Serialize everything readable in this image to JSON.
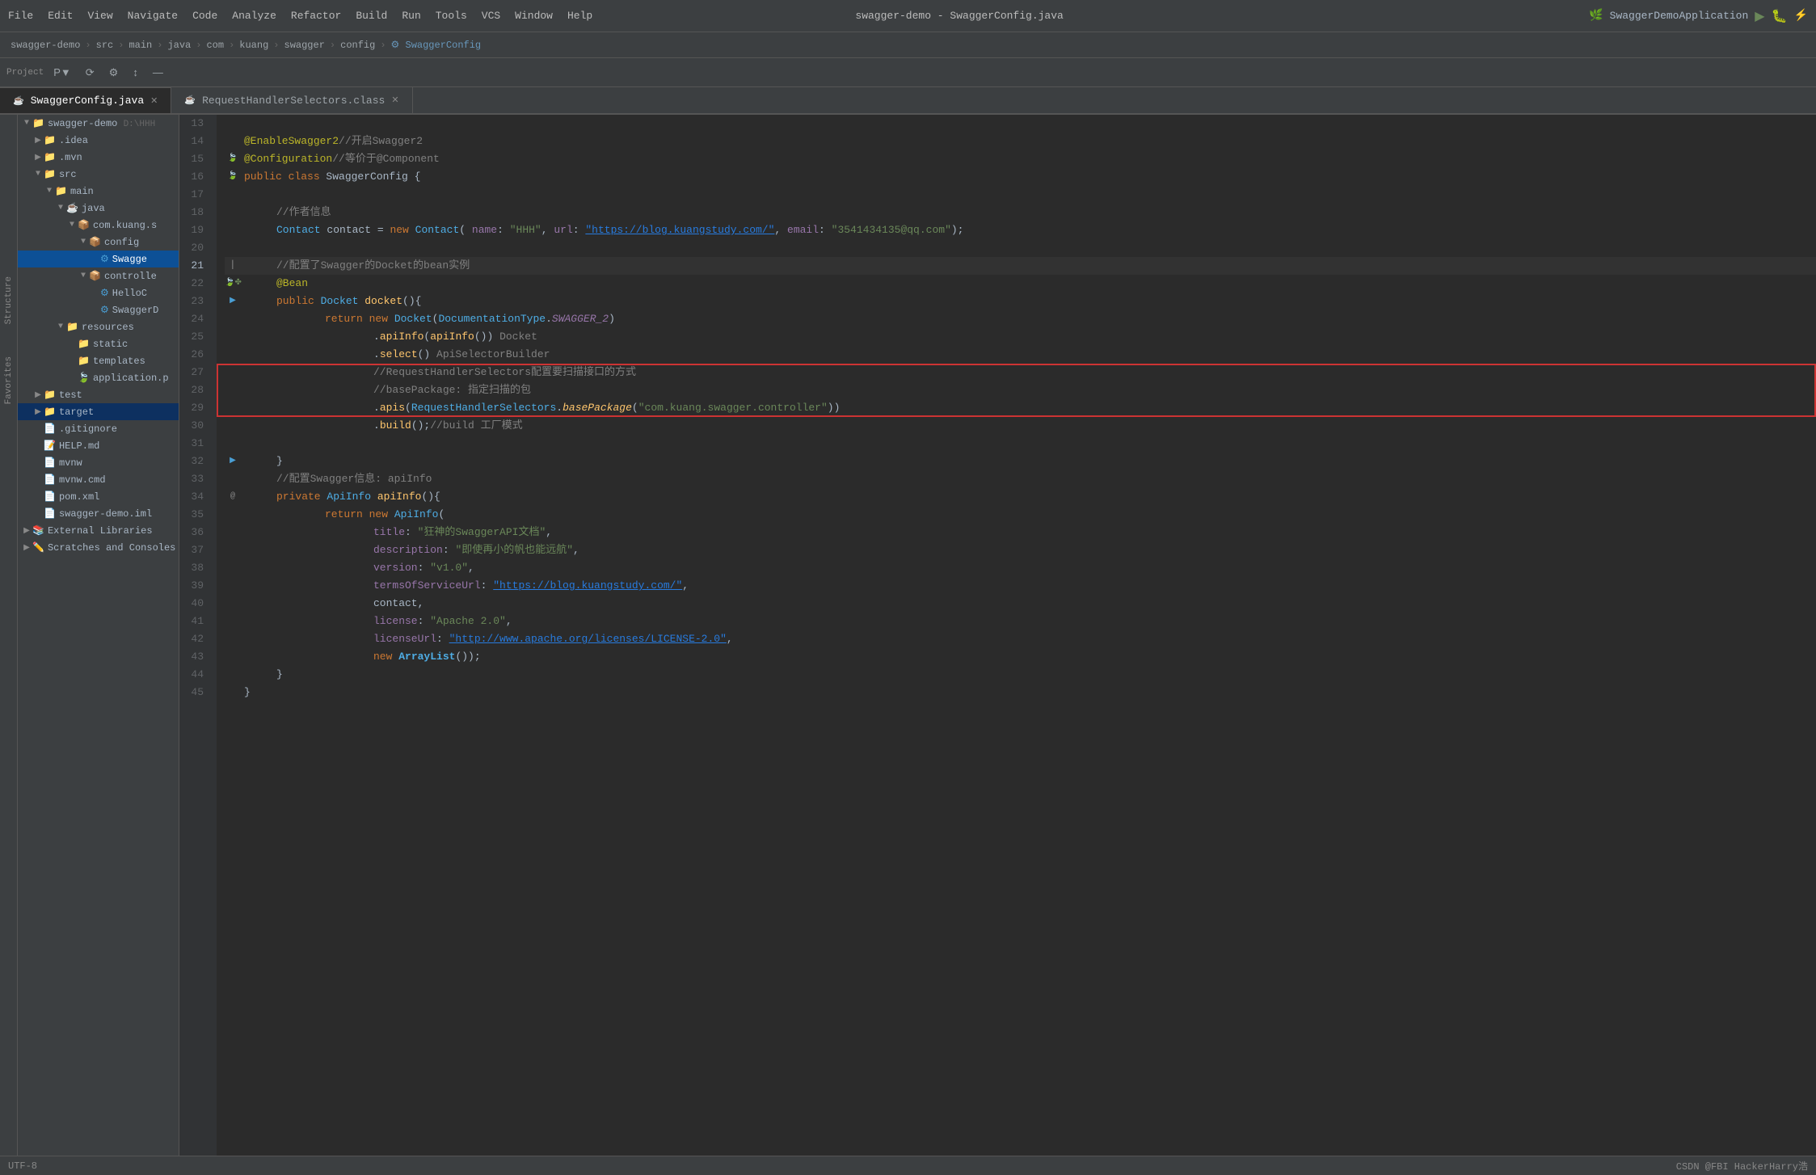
{
  "titlebar": {
    "menus": [
      "File",
      "Edit",
      "View",
      "Navigate",
      "Code",
      "Analyze",
      "Refactor",
      "Build",
      "Run",
      "Tools",
      "VCS",
      "Window",
      "Help"
    ],
    "title": "swagger-demo - SwaggerConfig.java"
  },
  "breadcrumb": {
    "items": [
      "swagger-demo",
      "src",
      "main",
      "java",
      "com",
      "kuang",
      "swagger",
      "config",
      "SwaggerConfig"
    ]
  },
  "tabs": [
    {
      "label": "SwaggerConfig.java",
      "active": true,
      "icon": "java"
    },
    {
      "label": "RequestHandlerSelectors.class",
      "active": false,
      "icon": "java"
    }
  ],
  "sidebar": {
    "project_label": "Project",
    "items": [
      {
        "id": "swagger-demo",
        "label": "swagger-demo",
        "type": "module",
        "indent": 0,
        "expanded": true,
        "suffix": "D:\\HHH"
      },
      {
        "id": "idea",
        "label": ".idea",
        "type": "folder",
        "indent": 1,
        "expanded": false
      },
      {
        "id": "mvn",
        "label": ".mvn",
        "type": "folder",
        "indent": 1,
        "expanded": false
      },
      {
        "id": "src",
        "label": "src",
        "type": "folder",
        "indent": 1,
        "expanded": true
      },
      {
        "id": "main",
        "label": "main",
        "type": "folder",
        "indent": 2,
        "expanded": true
      },
      {
        "id": "java",
        "label": "java",
        "type": "folder-java",
        "indent": 3,
        "expanded": true
      },
      {
        "id": "com.kuang.s",
        "label": "com.kuang.s",
        "type": "package",
        "indent": 4,
        "expanded": true
      },
      {
        "id": "config",
        "label": "config",
        "type": "package",
        "indent": 5,
        "expanded": true
      },
      {
        "id": "SwaggerConfig",
        "label": "Swagge",
        "type": "java-class",
        "indent": 6,
        "expanded": false,
        "selected": true
      },
      {
        "id": "controller",
        "label": "controlle",
        "type": "package",
        "indent": 5,
        "expanded": true
      },
      {
        "id": "HelloC",
        "label": "HelloC",
        "type": "java-class",
        "indent": 6
      },
      {
        "id": "SwaggerD",
        "label": "SwaggerD",
        "type": "java-class",
        "indent": 6
      },
      {
        "id": "resources",
        "label": "resources",
        "type": "folder-res",
        "indent": 3,
        "expanded": true
      },
      {
        "id": "static",
        "label": "static",
        "type": "folder",
        "indent": 4
      },
      {
        "id": "templates",
        "label": "templates",
        "type": "folder",
        "indent": 4
      },
      {
        "id": "application.p",
        "label": "application.p",
        "type": "prop",
        "indent": 4
      },
      {
        "id": "test",
        "label": "test",
        "type": "folder",
        "indent": 1,
        "expanded": false
      },
      {
        "id": "target",
        "label": "target",
        "type": "folder",
        "indent": 1,
        "expanded": false,
        "highlighted": true
      },
      {
        "id": "gitignore",
        "label": ".gitignore",
        "type": "file",
        "indent": 1
      },
      {
        "id": "HELP.md",
        "label": "HELP.md",
        "type": "md",
        "indent": 1
      },
      {
        "id": "mvnw",
        "label": "mvnw",
        "type": "file",
        "indent": 1
      },
      {
        "id": "mvnw.cmd",
        "label": "mvnw.cmd",
        "type": "file",
        "indent": 1
      },
      {
        "id": "pom.xml",
        "label": "pom.xml",
        "type": "xml",
        "indent": 1
      },
      {
        "id": "swagger-demo.iml",
        "label": "swagger-demo.iml",
        "type": "iml",
        "indent": 1
      },
      {
        "id": "external-libraries",
        "label": "External Libraries",
        "type": "folder",
        "indent": 0,
        "expanded": false
      },
      {
        "id": "scratches",
        "label": "Scratches and Consoles",
        "type": "folder",
        "indent": 0,
        "expanded": false
      }
    ]
  },
  "code": {
    "lines": [
      {
        "num": 13,
        "content": "",
        "gutter": ""
      },
      {
        "num": 14,
        "content": "@EnableSwagger2//开启Swagger2",
        "gutter": ""
      },
      {
        "num": 15,
        "content": "@Configuration//等价于@Component",
        "gutter": "leaf"
      },
      {
        "num": 16,
        "content": "public class SwaggerConfig {",
        "gutter": "leaf"
      },
      {
        "num": 17,
        "content": "",
        "gutter": ""
      },
      {
        "num": 18,
        "content": "    //作者信息",
        "gutter": ""
      },
      {
        "num": 19,
        "content": "    Contact contact = new Contact( name: \"HHH\", url: \"https://blog.kuangstudy.com/\", email: \"3541434135@qq.com\");",
        "gutter": ""
      },
      {
        "num": 20,
        "content": "",
        "gutter": ""
      },
      {
        "num": 21,
        "content": "    //配置了Swagger的Docket的bean实例",
        "gutter": "cursor"
      },
      {
        "num": 22,
        "content": "    @Bean",
        "gutter": "bean"
      },
      {
        "num": 23,
        "content": "    public Docket docket(){",
        "gutter": "arrow"
      },
      {
        "num": 24,
        "content": "        return new Docket(DocumentationType.SWAGGER_2)",
        "gutter": ""
      },
      {
        "num": 25,
        "content": "                .apiInfo(apiInfo()) Docket",
        "gutter": ""
      },
      {
        "num": 26,
        "content": "                .select() ApiSelectorBuilder",
        "gutter": ""
      },
      {
        "num": 27,
        "content": "                //RequestHandlerSelectors配置要扫描接口的方式",
        "gutter": ""
      },
      {
        "num": 28,
        "content": "                //basePackage: 指定扫描的包",
        "gutter": ""
      },
      {
        "num": 29,
        "content": "                .apis(RequestHandlerSelectors.basePackage(\"com.kuang.swagger.controller\"))",
        "gutter": ""
      },
      {
        "num": 30,
        "content": "                .build();//build 工厂模式",
        "gutter": ""
      },
      {
        "num": 31,
        "content": "",
        "gutter": ""
      },
      {
        "num": 32,
        "content": "    }",
        "gutter": "arrow"
      },
      {
        "num": 33,
        "content": "    //配置Swagger信息: apiInfo",
        "gutter": ""
      },
      {
        "num": 34,
        "content": "    private ApiInfo apiInfo(){",
        "gutter": "at"
      },
      {
        "num": 35,
        "content": "        return new ApiInfo(",
        "gutter": ""
      },
      {
        "num": 36,
        "content": "                title: \"狂神的SwaggerAPI文档\",",
        "gutter": ""
      },
      {
        "num": 37,
        "content": "                description: \"即使再小的帆也能远航\",",
        "gutter": ""
      },
      {
        "num": 38,
        "content": "                version: \"v1.0\",",
        "gutter": ""
      },
      {
        "num": 39,
        "content": "                termsOfServiceUrl: \"https://blog.kuangstudy.com/\",",
        "gutter": ""
      },
      {
        "num": 40,
        "content": "                contact,",
        "gutter": ""
      },
      {
        "num": 41,
        "content": "                license: \"Apache 2.0\",",
        "gutter": ""
      },
      {
        "num": 42,
        "content": "                licenseUrl: \"http://www.apache.org/licenses/LICENSE-2.0\",",
        "gutter": ""
      },
      {
        "num": 43,
        "content": "                new ArrayList());",
        "gutter": ""
      },
      {
        "num": 44,
        "content": "    }",
        "gutter": ""
      },
      {
        "num": 45,
        "content": "}",
        "gutter": ""
      }
    ]
  },
  "statusbar": {
    "right_text": "CSDN @FBI HackerHarry浩"
  },
  "run_config": {
    "name": "SwaggerDemoApplication",
    "icon": "▶"
  }
}
